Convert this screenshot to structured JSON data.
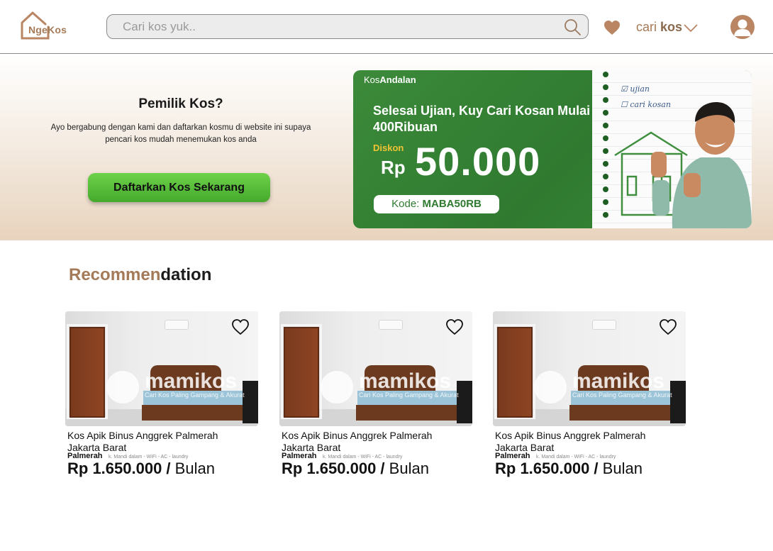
{
  "header": {
    "logo_text": "NgeKos",
    "search_placeholder": "Cari kos yuk..",
    "menu_prefix": "cari",
    "menu_label": "kos"
  },
  "hero": {
    "owner_title": "Pemilik Kos?",
    "owner_desc": "Ayo bergabung dengan kami dan daftarkan kosmu di website ini supaya pencari kos mudah menemukan kos anda",
    "cta_label": "Daftarkan Kos Sekarang",
    "banner": {
      "brand_prefix": "Kos",
      "brand_bold": "Andalan",
      "headline": "Selesai Ujian, Kuy Cari Kosan Mulai 400Ribuan",
      "discount_label": "Diskon",
      "currency": "Rp",
      "amount": "50.000",
      "code_label": "Kode:",
      "code_value": "MABA50RB",
      "note_1": "ujian",
      "note_2": "cari kosan"
    }
  },
  "recommendation": {
    "title_accent": "Recommen",
    "title_rest": "dation",
    "cards": [
      {
        "name": "Kos Apik Binus Anggrek Palmerah",
        "area": "Jakarta Barat",
        "location": "Palmerah",
        "facilities": "k. Mandi dalam - WiFi - AC - laundry",
        "price": "Rp 1.650.000 /",
        "unit": "Bulan",
        "watermark": "mamikos",
        "watermark_sub": "Cari Kos Paling Gampang & Akurat"
      },
      {
        "name": "Kos Apik Binus Anggrek Palmerah",
        "area": "Jakarta Barat",
        "location": "Palmerah",
        "facilities": "k. Mandi dalam - WiFi - AC - laundry",
        "price": "Rp 1.650.000 /",
        "unit": "Bulan",
        "watermark": "mamikos",
        "watermark_sub": "Cari Kos Paling Gampang & Akurat"
      },
      {
        "name": "Kos Apik Binus Anggrek Palmerah",
        "area": "Jakarta Barat",
        "location": "Palmerah",
        "facilities": "k. Mandi dalam - WiFi - AC - laundry",
        "price": "Rp 1.650.000 /",
        "unit": "Bulan",
        "watermark": "mamikos",
        "watermark_sub": "Cari Kos Paling Gampang & Akurat"
      }
    ]
  },
  "colors": {
    "brand": "#a47a58",
    "cta_green": "#44a92c",
    "banner_green": "#2f7a30"
  }
}
